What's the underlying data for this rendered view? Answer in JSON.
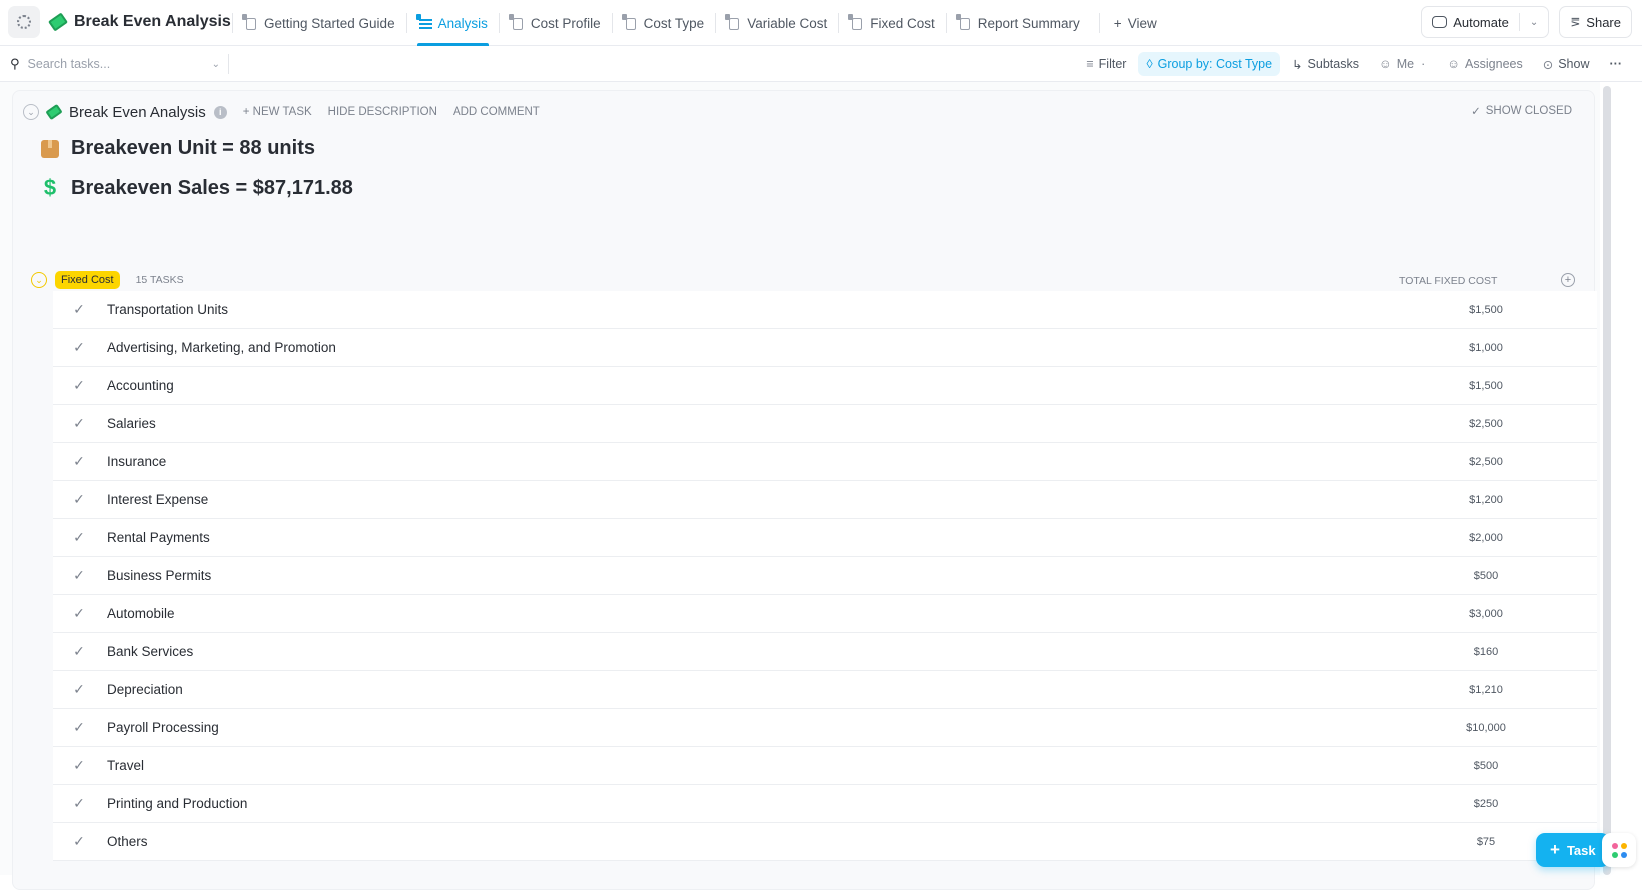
{
  "header": {
    "list_title": "Break Even Analysis",
    "tabs": [
      {
        "label": "Getting Started Guide",
        "icon": "doc-icon",
        "active": false
      },
      {
        "label": "Analysis",
        "icon": "list-icon",
        "active": true
      },
      {
        "label": "Cost Profile",
        "icon": "table-icon",
        "active": false
      },
      {
        "label": "Cost Type",
        "icon": "board-icon",
        "active": false
      },
      {
        "label": "Variable Cost",
        "icon": "table-icon",
        "active": false
      },
      {
        "label": "Fixed Cost",
        "icon": "table-icon",
        "active": false
      },
      {
        "label": "Report Summary",
        "icon": "doc-icon",
        "active": false
      }
    ],
    "add_view_label": "View",
    "automate_label": "Automate",
    "share_label": "Share"
  },
  "toolbar": {
    "search_placeholder": "Search tasks...",
    "filter_label": "Filter",
    "group_by_label": "Group by: Cost Type",
    "subtasks_label": "Subtasks",
    "me_label": "Me",
    "assignees_label": "Assignees",
    "show_label": "Show"
  },
  "list": {
    "title": "Break Even Analysis",
    "new_task": "+ NEW TASK",
    "hide_description": "HIDE DESCRIPTION",
    "add_comment": "ADD COMMENT",
    "show_closed": "SHOW CLOSED",
    "description": {
      "unit_line": "Breakeven Unit = 88 units",
      "sales_line": "Breakeven Sales = $87,171.88"
    }
  },
  "group": {
    "name": "Fixed Cost",
    "color": "#fcd500",
    "task_count": "15 TASKS",
    "column_header": "TOTAL FIXED COST",
    "tasks": [
      {
        "name": "Transportation Units",
        "total": "$1,500"
      },
      {
        "name": "Advertising, Marketing, and Promotion",
        "total": "$1,000"
      },
      {
        "name": "Accounting",
        "total": "$1,500"
      },
      {
        "name": "Salaries",
        "total": "$2,500"
      },
      {
        "name": "Insurance",
        "total": "$2,500"
      },
      {
        "name": "Interest Expense",
        "total": "$1,200"
      },
      {
        "name": "Rental Payments",
        "total": "$2,000"
      },
      {
        "name": "Business Permits",
        "total": "$500"
      },
      {
        "name": "Automobile",
        "total": "$3,000"
      },
      {
        "name": "Bank Services",
        "total": "$160"
      },
      {
        "name": "Depreciation",
        "total": "$1,210"
      },
      {
        "name": "Payroll Processing",
        "total": "$10,000"
      },
      {
        "name": "Travel",
        "total": "$500"
      },
      {
        "name": "Printing and Production",
        "total": "$250"
      },
      {
        "name": "Others",
        "total": "$75"
      }
    ]
  },
  "fab": {
    "task_label": "Task"
  },
  "colors": {
    "accent": "#0b9ee0",
    "fab": "#14b2f0",
    "group_badge": "#fcd500"
  }
}
